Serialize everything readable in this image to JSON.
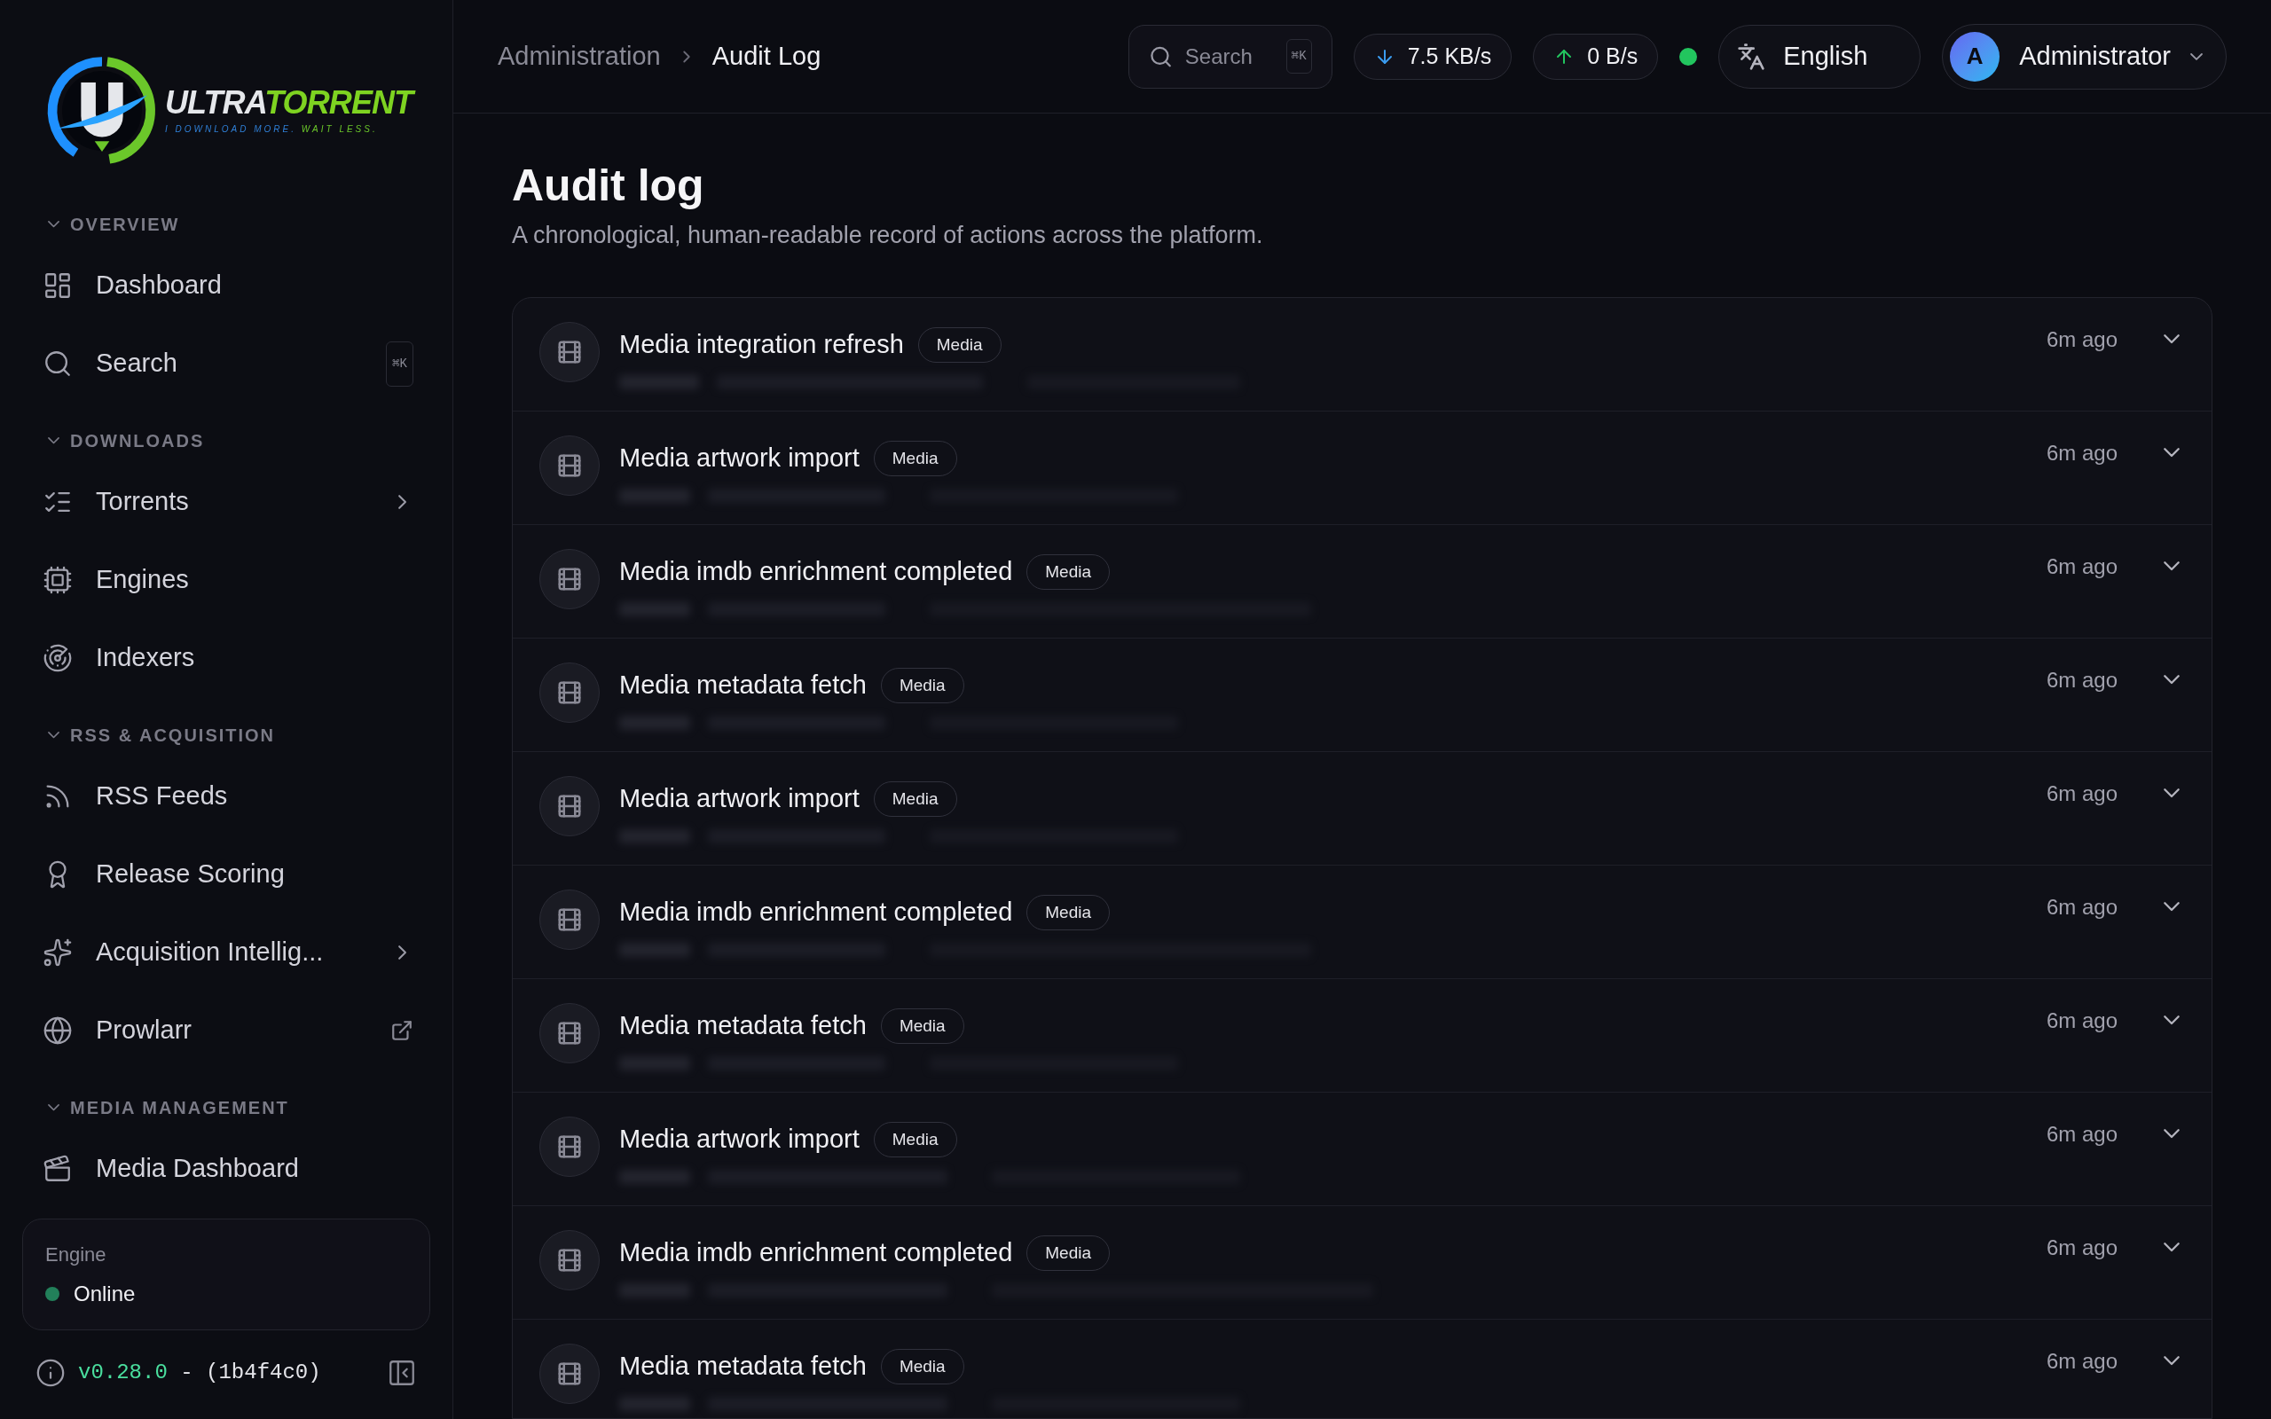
{
  "logo": {
    "name_parts": [
      "ULTRA",
      "TORRENT"
    ],
    "tagline_parts": [
      "I DOWNLOAD MORE.",
      "WAIT LESS."
    ]
  },
  "sidebar": {
    "sections": [
      {
        "title": "OVERVIEW",
        "expanded": true,
        "items": [
          {
            "label": "Dashboard",
            "kind": "plain"
          },
          {
            "label": "Search",
            "kind": "shortcut",
            "shortcut": "⌘K"
          }
        ]
      },
      {
        "title": "DOWNLOADS",
        "expanded": true,
        "items": [
          {
            "label": "Torrents",
            "kind": "submenu"
          },
          {
            "label": "Engines",
            "kind": "plain"
          },
          {
            "label": "Indexers",
            "kind": "plain"
          }
        ]
      },
      {
        "title": "RSS & ACQUISITION",
        "expanded": true,
        "items": [
          {
            "label": "RSS Feeds",
            "kind": "plain"
          },
          {
            "label": "Release Scoring",
            "kind": "plain"
          },
          {
            "label": "Acquisition Intellig...",
            "kind": "submenu"
          },
          {
            "label": "Prowlarr",
            "kind": "external"
          }
        ]
      },
      {
        "title": "MEDIA MANAGEMENT",
        "expanded": true,
        "items": [
          {
            "label": "Media Dashboard",
            "kind": "plain"
          }
        ]
      }
    ],
    "engine": {
      "label": "Engine",
      "status": "Online",
      "color": "#22805a"
    },
    "version": {
      "number": "v0.28.0",
      "build": "- (1b4f4c0)"
    }
  },
  "breadcrumb": [
    "Administration",
    "Audit Log"
  ],
  "topbar": {
    "search": {
      "placeholder": "Search",
      "shortcut": "⌘K"
    },
    "download": "7.5 KB/s",
    "upload": "0 B/s",
    "connection": {
      "color": "#22c55e"
    },
    "language": "English",
    "user": {
      "initial": "A",
      "name": "Administrator"
    }
  },
  "page": {
    "title": "Audit log",
    "subtitle": "A chronological, human-readable record of actions across the platform."
  },
  "entries": [
    {
      "title": "Media integration refresh",
      "tag": "Media",
      "time": "6m ago",
      "expanded": false
    },
    {
      "title": "Media artwork import",
      "tag": "Media",
      "time": "6m ago",
      "expanded": false
    },
    {
      "title": "Media imdb enrichment completed",
      "tag": "Media",
      "time": "6m ago",
      "expanded": false
    },
    {
      "title": "Media metadata fetch",
      "tag": "Media",
      "time": "6m ago",
      "expanded": false
    },
    {
      "title": "Media artwork import",
      "tag": "Media",
      "time": "6m ago",
      "expanded": false
    },
    {
      "title": "Media imdb enrichment completed",
      "tag": "Media",
      "time": "6m ago",
      "expanded": false
    },
    {
      "title": "Media metadata fetch",
      "tag": "Media",
      "time": "6m ago",
      "expanded": false
    },
    {
      "title": "Media artwork import",
      "tag": "Media",
      "time": "6m ago",
      "expanded": false
    },
    {
      "title": "Media imdb enrichment completed",
      "tag": "Media",
      "time": "6m ago",
      "expanded": false
    },
    {
      "title": "Media metadata fetch",
      "tag": "Media",
      "time": "6m ago",
      "expanded": false
    }
  ]
}
